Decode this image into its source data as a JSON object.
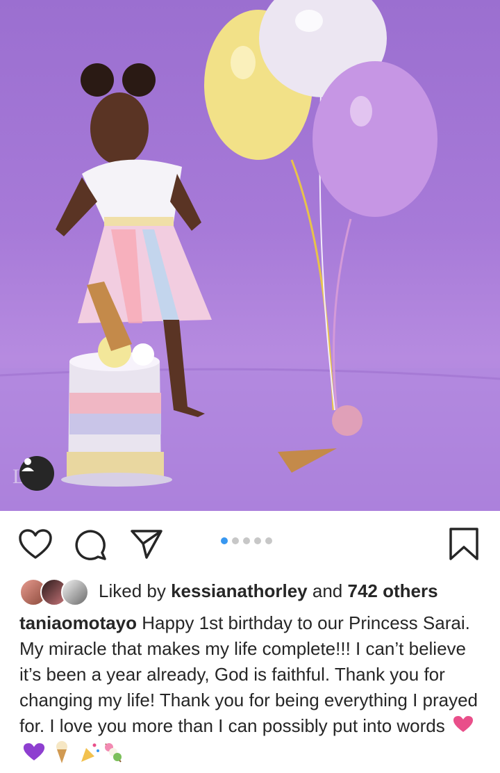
{
  "post": {
    "image_alt": "Toddler in a tutu beside a cake and balloons on a purple backdrop",
    "carousel": {
      "count": 5,
      "active_index": 0
    }
  },
  "actions": {
    "like_icon": "heart-icon",
    "comment_icon": "comment-icon",
    "share_icon": "send-icon",
    "save_icon": "bookmark-icon"
  },
  "likes": {
    "prefix": "Liked by",
    "user": "kessianathorley",
    "connector": "and",
    "others": "742 others"
  },
  "caption": {
    "username": "taniaomotayo",
    "text": "Happy 1st birthday to our Princess Sarai. My miracle that makes my life complete!!! I can’t believe it’s been a year already, God is faithful. Thank you for changing my life! Thank you for being everything I prayed for. I love you more than I can possibly put into words",
    "emojis": [
      "pink-heart",
      "purple-heart",
      "ice-cream",
      "party-popper",
      "dango"
    ]
  },
  "colors": {
    "accent": "#3897f0",
    "backdrop": "#a77ad8",
    "text": "#262626"
  }
}
